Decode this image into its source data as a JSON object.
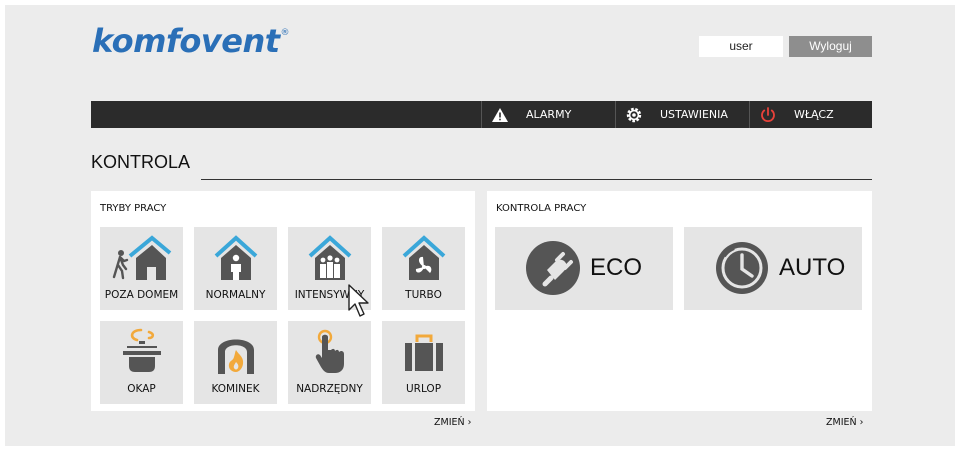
{
  "header": {
    "logo_text": "komfovent",
    "logo_mark": "®",
    "username": "user",
    "logout_label": "Wyloguj"
  },
  "nav": {
    "alarms_label": "ALARMY",
    "settings_label": "USTAWIENIA",
    "power_label": "WŁĄCZ"
  },
  "page": {
    "title": "KONTROLA"
  },
  "modes_panel": {
    "title": "TRYBY PRACY",
    "change_label": "ZMIEŃ ›",
    "modes": [
      {
        "label": "POZA DOMEM",
        "icon": "house-away-icon"
      },
      {
        "label": "NORMALNY",
        "icon": "house-person-icon"
      },
      {
        "label": "INTENSYWNY",
        "icon": "house-people-icon"
      },
      {
        "label": "TURBO",
        "icon": "house-fan-icon"
      },
      {
        "label": "OKAP",
        "icon": "cooking-pot-icon"
      },
      {
        "label": "KOMINEK",
        "icon": "fireplace-icon"
      },
      {
        "label": "NADRZĘDNY",
        "icon": "hand-pointer-icon"
      },
      {
        "label": "URLOP",
        "icon": "suitcase-icon"
      }
    ]
  },
  "control_panel": {
    "title": "KONTROLA PRACY",
    "change_label": "ZMIEŃ ›",
    "eco_label": "ECO",
    "auto_label": "AUTO"
  },
  "colors": {
    "brand_blue": "#2a6fb7",
    "icon_blue": "#3aa7d9",
    "icon_dark": "#555555",
    "icon_orange": "#f2a93b",
    "power_red": "#e8423a",
    "navbar": "#2b2b2b"
  }
}
